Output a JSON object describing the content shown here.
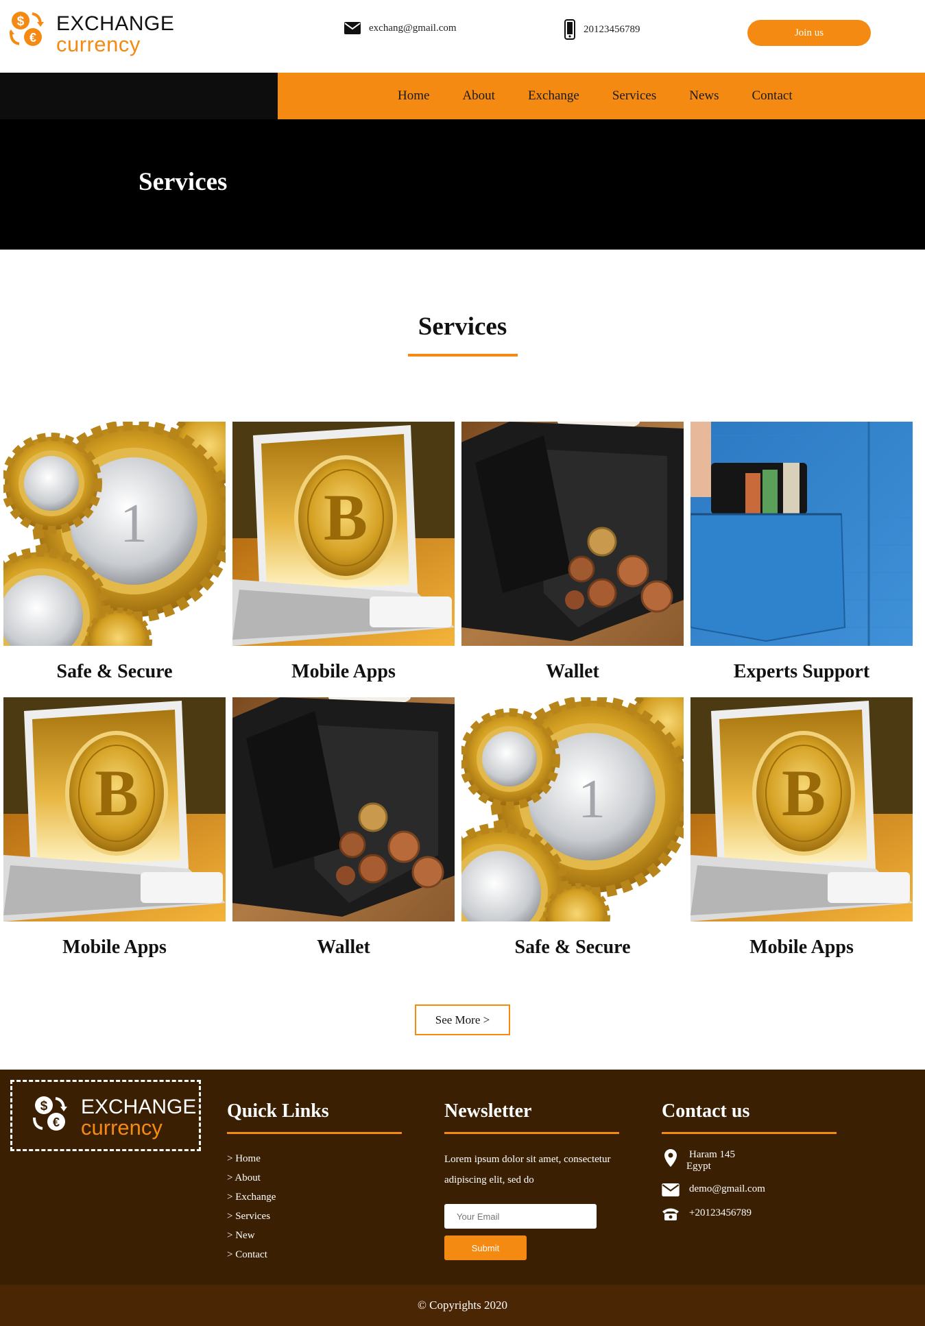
{
  "brand": {
    "line1": "EXCHANGE",
    "line2": "currency"
  },
  "header": {
    "email": "exchang@gmail.com",
    "phone": "20123456789",
    "join_label": "Join us"
  },
  "nav": {
    "items": [
      "Home",
      "About",
      "Exchange",
      "Services",
      "News",
      "Contact"
    ]
  },
  "hero": {
    "title": "Services"
  },
  "services": {
    "title": "Services",
    "cards": [
      {
        "label": "Safe & Secure",
        "image": "euro-gears"
      },
      {
        "label": "Mobile Apps",
        "image": "bitcoin-laptop"
      },
      {
        "label": "Wallet",
        "image": "coin-wallet"
      },
      {
        "label": "Experts Support",
        "image": "pocket-wallet"
      },
      {
        "label": "Mobile Apps",
        "image": "bitcoin-laptop"
      },
      {
        "label": "Wallet",
        "image": "coin-wallet"
      },
      {
        "label": "Safe & Secure",
        "image": "euro-gears"
      },
      {
        "label": "Mobile Apps",
        "image": "bitcoin-laptop"
      }
    ],
    "see_more": "See More >"
  },
  "footer": {
    "quick_links": {
      "title": "Quick Links",
      "items": [
        "> Home",
        "> About",
        "> Exchange",
        "> Services",
        "> New",
        "> Contact"
      ]
    },
    "newsletter": {
      "title": "Newsletter",
      "text": "Lorem ipsum dolor sit amet, consectetur adipiscing elit, sed do",
      "placeholder": "Your Email",
      "submit": "Submit"
    },
    "contact": {
      "title": "Contact us",
      "address_line1": "Haram 145",
      "address_line2": "Egypt",
      "email": "demo@gmail.com",
      "phone": "+20123456789"
    },
    "copyright": "© Copyrights 2020"
  },
  "colors": {
    "accent": "#f58a12",
    "footer_bg": "#3a1f03",
    "copyright_bg": "#4a2604",
    "dark": "#0d0d0d"
  },
  "icons": {
    "logo": "currency-exchange-icon",
    "email": "envelope-icon",
    "phone": "mobile-phone-icon",
    "location": "map-pin-icon",
    "telephone": "telephone-icon"
  }
}
